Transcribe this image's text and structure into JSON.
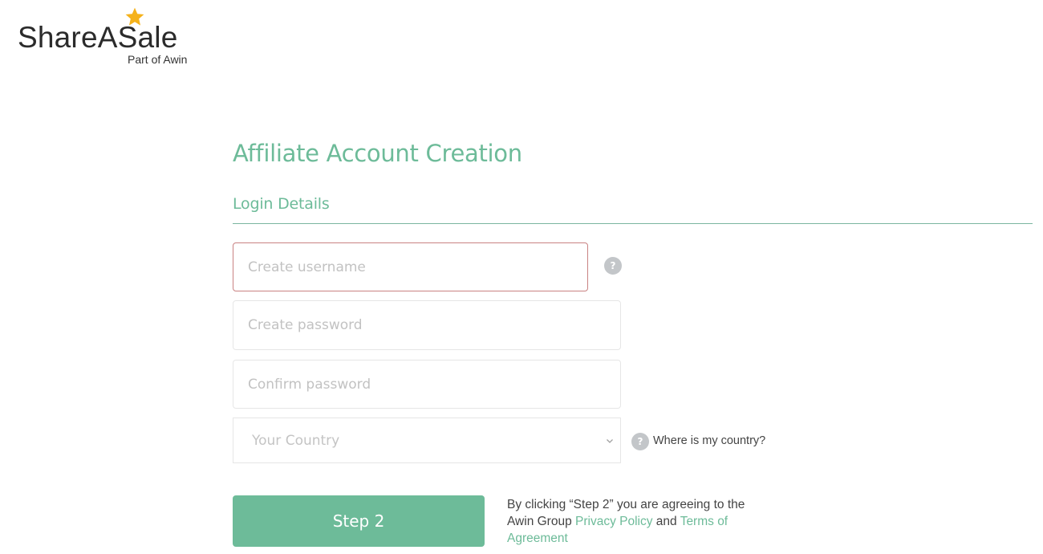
{
  "logo": {
    "brand": "ShareASale",
    "tagline": "Part of Awin",
    "star_color": "#f5b21b"
  },
  "page": {
    "title": "Affiliate Account Creation",
    "section": "Login Details"
  },
  "form": {
    "username": {
      "placeholder": "Create username",
      "value": ""
    },
    "password": {
      "placeholder": "Create password",
      "value": ""
    },
    "confirm_password": {
      "placeholder": "Confirm password",
      "value": ""
    },
    "country": {
      "selected": "Your Country"
    },
    "help_glyph": "?",
    "country_help_link": "Where is my country?"
  },
  "action": {
    "step_button": "Step 2",
    "terms_prefix": "By clicking “Step 2” you are agreeing to the Awin Group ",
    "privacy_link": "Privacy Policy",
    "terms_and": " and ",
    "terms_link": "Terms of Agreement"
  },
  "colors": {
    "accent": "#6dbb99",
    "error_border": "#c98282"
  }
}
